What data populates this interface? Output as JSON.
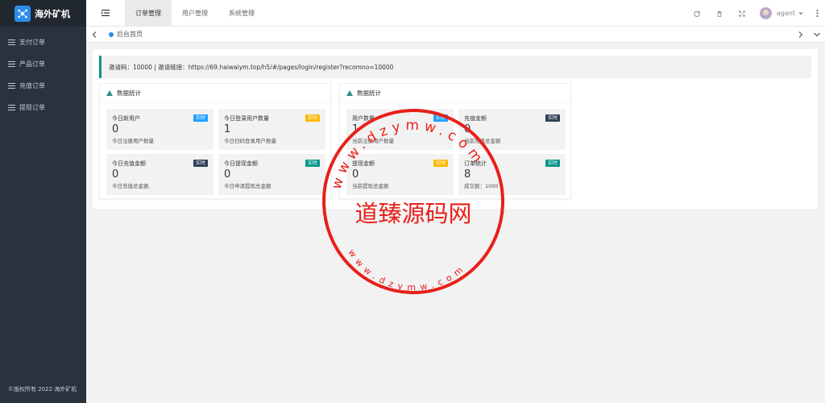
{
  "app": {
    "name": "海外矿机"
  },
  "sidebar": {
    "items": [
      {
        "label": "支付订单"
      },
      {
        "label": "产品订单"
      },
      {
        "label": "充值订单"
      },
      {
        "label": "提现订单"
      }
    ],
    "copyright": "©版权所有 2022 海外矿机"
  },
  "header": {
    "tabs": [
      {
        "label": "订单管理",
        "active": true
      },
      {
        "label": "用户管理",
        "active": false
      },
      {
        "label": "系统管理",
        "active": false
      }
    ],
    "icons": [
      "refresh-icon",
      "trash-icon",
      "fullscreen-icon",
      "more-icon"
    ],
    "user": "agent"
  },
  "tabbar": {
    "current": "后台首页"
  },
  "notice": "邀请码：10000 | 邀请链接：https://69.haiwaiym.top/h5/#/pages/login/register?recomno=10000",
  "cards": [
    {
      "title": "数据统计",
      "stats": [
        {
          "title": "今日新用户",
          "value": "0",
          "desc": "今日注册用户数量",
          "badge": "实时",
          "badge_color": "#1e9fff"
        },
        {
          "title": "今日登录用户数量",
          "value": "1",
          "desc": "今日扫码登录用户数量",
          "badge": "实时",
          "badge_color": "#ffb800"
        },
        {
          "title": "今日充值金额",
          "value": "0",
          "desc": "今日充值总金额.",
          "badge": "实时",
          "badge_color": "#2f4056"
        },
        {
          "title": "今日提现金额",
          "value": "0",
          "desc": "今日申请提现总金额",
          "badge": "实时",
          "badge_color": "#009688"
        }
      ]
    },
    {
      "title": "数据统计",
      "stats": [
        {
          "title": "用户数量",
          "value": "1",
          "desc": "当前注册用户数量",
          "badge": "实时",
          "badge_color": "#1e9fff"
        },
        {
          "title": "充值金额",
          "value": "0",
          "desc": "当前充值总金额",
          "badge": "实时",
          "badge_color": "#2f4056"
        },
        {
          "title": "提现金额",
          "value": "0",
          "desc": "当前提现总金额",
          "badge": "实时",
          "badge_color": "#ffb800"
        },
        {
          "title": "订单统计",
          "value": "8",
          "desc": "成交额：1000",
          "badge": "实时",
          "badge_color": "#009688"
        }
      ]
    }
  ],
  "watermark": {
    "center_text": "道臻源码网",
    "top_text": "www.dzymw.com",
    "bottom_text": "www.dzymw.com",
    "color": "#e8201a"
  }
}
